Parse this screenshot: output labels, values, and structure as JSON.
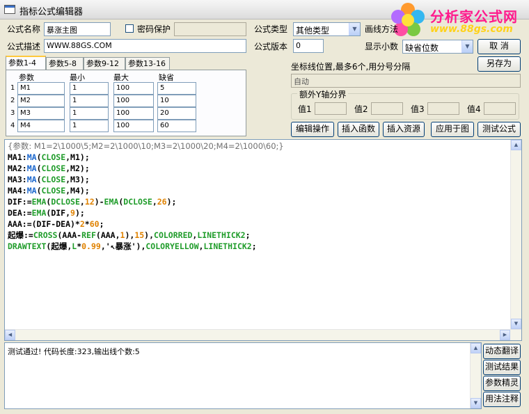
{
  "window": {
    "title": "指标公式编辑器"
  },
  "brand": {
    "name": "分析家公式网",
    "url": "www.88gs.com"
  },
  "form": {
    "name_label": "公式名称",
    "name_value": "暴涨主图",
    "password_label": "密码保护",
    "desc_label": "公式描述",
    "desc_value": "WWW.88GS.COM",
    "type_label": "公式类型",
    "type_value": "其他类型",
    "draw_label": "画线方法",
    "version_label": "公式版本",
    "version_value": "0",
    "decimals_label": "显示小数",
    "decimals_value": "缺省位数",
    "cancel_label": "取  消",
    "saveas_label": "另存为"
  },
  "tabs": [
    "参数1-4",
    "参数5-8",
    "参数9-12",
    "参数13-16"
  ],
  "params": {
    "headers": [
      "参数",
      "最小",
      "最大",
      "缺省"
    ],
    "rows": [
      {
        "num": "1",
        "name": "M1",
        "min": "1",
        "max": "100",
        "def": "5"
      },
      {
        "num": "2",
        "name": "M2",
        "min": "1",
        "max": "100",
        "def": "10"
      },
      {
        "num": "3",
        "name": "M3",
        "min": "1",
        "max": "100",
        "def": "20"
      },
      {
        "num": "4",
        "name": "M4",
        "min": "1",
        "max": "100",
        "def": "60"
      }
    ]
  },
  "axis": {
    "label": "坐标线位置,最多6个,用分号分隔",
    "value": "自动",
    "extra_title": "额外Y轴分界",
    "v1": "值1",
    "v2": "值2",
    "v3": "值3",
    "v4": "值4"
  },
  "actions": [
    "编辑操作",
    "插入函数",
    "插入资源",
    "应用于图",
    "测试公式"
  ],
  "code": [
    [
      {
        "t": "{参数: M1=2\\1000\\5;M2=2\\1000\\10;M3=2\\1000\\20;M4=2\\1000\\60;}",
        "c": "gray"
      }
    ],
    [
      {
        "t": "MA1:",
        "c": "black"
      },
      {
        "t": "MA",
        "c": "blue"
      },
      {
        "t": "(",
        "c": "black"
      },
      {
        "t": "CLOSE",
        "c": "green"
      },
      {
        "t": ",M1);",
        "c": "black"
      }
    ],
    [
      {
        "t": "MA2:",
        "c": "black"
      },
      {
        "t": "MA",
        "c": "blue"
      },
      {
        "t": "(",
        "c": "black"
      },
      {
        "t": "CLOSE",
        "c": "green"
      },
      {
        "t": ",M2);",
        "c": "black"
      }
    ],
    [
      {
        "t": "MA3:",
        "c": "black"
      },
      {
        "t": "MA",
        "c": "blue"
      },
      {
        "t": "(",
        "c": "black"
      },
      {
        "t": "CLOSE",
        "c": "green"
      },
      {
        "t": ",M3);",
        "c": "black"
      }
    ],
    [
      {
        "t": "MA4:",
        "c": "black"
      },
      {
        "t": "MA",
        "c": "blue"
      },
      {
        "t": "(",
        "c": "black"
      },
      {
        "t": "CLOSE",
        "c": "green"
      },
      {
        "t": ",M4);",
        "c": "black"
      }
    ],
    [
      {
        "t": "DIF:=",
        "c": "black"
      },
      {
        "t": "EMA",
        "c": "green"
      },
      {
        "t": "(",
        "c": "black"
      },
      {
        "t": "DCLOSE",
        "c": "green"
      },
      {
        "t": ",",
        "c": "black"
      },
      {
        "t": "12",
        "c": "orange"
      },
      {
        "t": ")-",
        "c": "black"
      },
      {
        "t": "EMA",
        "c": "green"
      },
      {
        "t": "(",
        "c": "black"
      },
      {
        "t": "DCLOSE",
        "c": "green"
      },
      {
        "t": ",",
        "c": "black"
      },
      {
        "t": "26",
        "c": "orange"
      },
      {
        "t": ");",
        "c": "black"
      }
    ],
    [
      {
        "t": "DEA:=",
        "c": "black"
      },
      {
        "t": "EMA",
        "c": "green"
      },
      {
        "t": "(DIF,",
        "c": "black"
      },
      {
        "t": "9",
        "c": "orange"
      },
      {
        "t": ");",
        "c": "black"
      }
    ],
    [
      {
        "t": "AAA:=(DIF-DEA)*",
        "c": "black"
      },
      {
        "t": "2",
        "c": "orange"
      },
      {
        "t": "*",
        "c": "black"
      },
      {
        "t": "60",
        "c": "orange"
      },
      {
        "t": ";",
        "c": "black"
      }
    ],
    [
      {
        "t": "起爆:=",
        "c": "black"
      },
      {
        "t": "CROSS",
        "c": "green"
      },
      {
        "t": "(AAA-",
        "c": "black"
      },
      {
        "t": "REF",
        "c": "green"
      },
      {
        "t": "(AAA,",
        "c": "black"
      },
      {
        "t": "1",
        "c": "orange"
      },
      {
        "t": "),",
        "c": "black"
      },
      {
        "t": "15",
        "c": "orange"
      },
      {
        "t": "),",
        "c": "black"
      },
      {
        "t": "COLORRED",
        "c": "green"
      },
      {
        "t": ",",
        "c": "black"
      },
      {
        "t": "LINETHICK2",
        "c": "green"
      },
      {
        "t": ";",
        "c": "black"
      }
    ],
    [
      {
        "t": "DRAWTEXT",
        "c": "green"
      },
      {
        "t": "(起爆,",
        "c": "black"
      },
      {
        "t": "L",
        "c": "green"
      },
      {
        "t": "*",
        "c": "black"
      },
      {
        "t": "0.99",
        "c": "orange"
      },
      {
        "t": ",'↖暴涨'),",
        "c": "black"
      },
      {
        "t": "COLORYELLOW",
        "c": "green"
      },
      {
        "t": ",",
        "c": "black"
      },
      {
        "t": "LINETHICK2",
        "c": "green"
      },
      {
        "t": ";",
        "c": "black"
      }
    ]
  ],
  "output": {
    "text": "测试通过! 代码长度:323,输出线个数:5"
  },
  "side_buttons": [
    "动态翻译",
    "测试结果",
    "参数精灵",
    "用法注释"
  ]
}
